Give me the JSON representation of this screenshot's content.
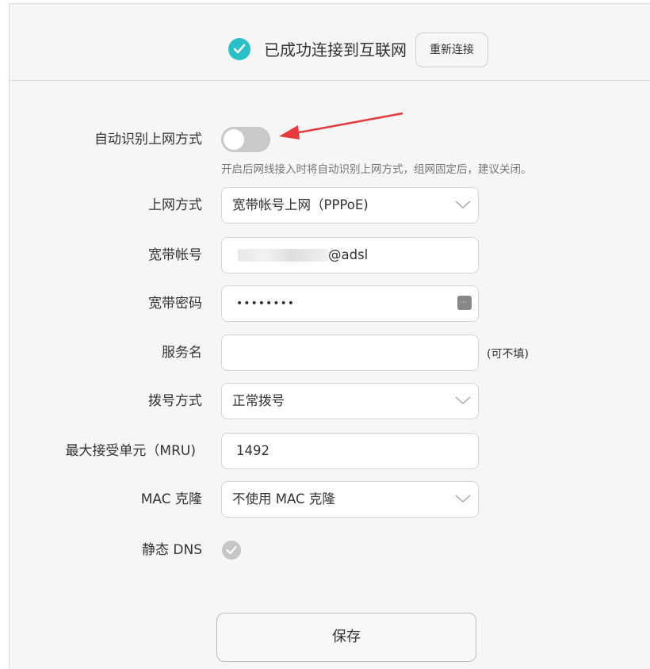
{
  "status": {
    "text": "已成功连接到互联网",
    "reconnect_label": "重新连接",
    "icon": "check-circle-icon",
    "icon_color": "#29c1c7"
  },
  "auto_detect": {
    "label": "自动识别上网方式",
    "enabled": false,
    "hint": "开启后网线接入时将自动识别上网方式，组网固定后，建议关闭。"
  },
  "connection_type": {
    "label": "上网方式",
    "value": "宽带帐号上网（PPPoE)"
  },
  "account": {
    "label": "宽带帐号",
    "visible_suffix": "@adsl"
  },
  "password": {
    "label": "宽带密码",
    "masked_value": "••••••••",
    "icon": "keyboard-icon"
  },
  "service_name": {
    "label": "服务名",
    "value": "",
    "note": "(可不填)"
  },
  "dial_mode": {
    "label": "拨号方式",
    "value": "正常拨号"
  },
  "mru": {
    "label": "最大接受单元（MRU)",
    "value": "1492"
  },
  "mac_clone": {
    "label": "MAC 克隆",
    "value": "不使用 MAC 克隆"
  },
  "static_dns": {
    "label": "静态 DNS",
    "checked": true
  },
  "save_label": "保存",
  "annotation_color": "#e8393d"
}
